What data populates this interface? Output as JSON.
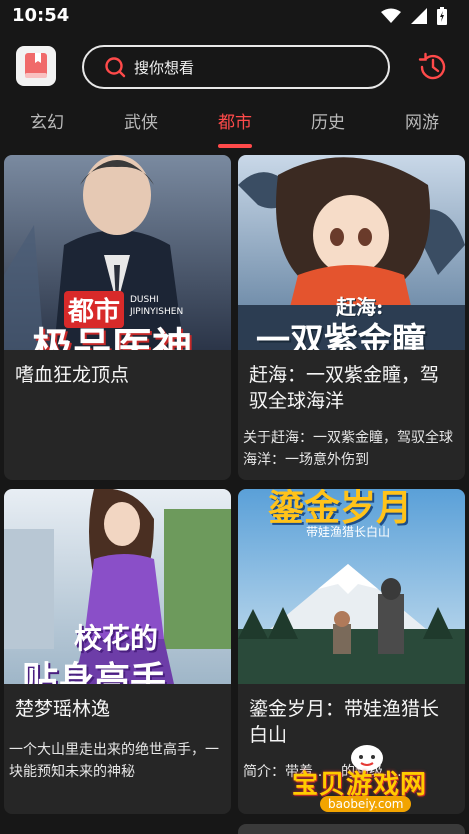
{
  "status_bar": {
    "time": "10:54"
  },
  "search": {
    "placeholder": "搜你想看"
  },
  "tabs": [
    {
      "label": "玄幻"
    },
    {
      "label": "武侠"
    },
    {
      "label": "都市"
    },
    {
      "label": "历史"
    },
    {
      "label": "网游"
    }
  ],
  "active_tab": "都市",
  "colors": {
    "accent": "#ff4a4a",
    "background": "#171717",
    "card": "#262626"
  },
  "books": [
    {
      "title": "嗜血狂龙顶点",
      "description": "",
      "cover_text": [
        "都市",
        "DUSHI",
        "JIPINYISHEN",
        "极品医神"
      ]
    },
    {
      "title": "赶海：一双紫金瞳，驾驭全球海洋",
      "description": "关于赶海：一双紫金瞳，驾驭全球海洋：一场意外伤到",
      "cover_text": [
        "赶海:",
        "一双紫金瞳"
      ]
    },
    {
      "title": "楚梦瑶林逸",
      "description": "一个大山里走出来的绝世高手，一块能预知未来的神秘",
      "cover_text": [
        "校花的",
        "贴身高手"
      ]
    },
    {
      "title": "鎏金岁月：带娃渔猎长白山",
      "description": "简介：带着……的超级……",
      "cover_text": [
        "鎏金岁月",
        "带娃渔猎长白山"
      ]
    }
  ],
  "watermark": {
    "text": "宝贝游戏网",
    "url": "baobeiy.com"
  }
}
